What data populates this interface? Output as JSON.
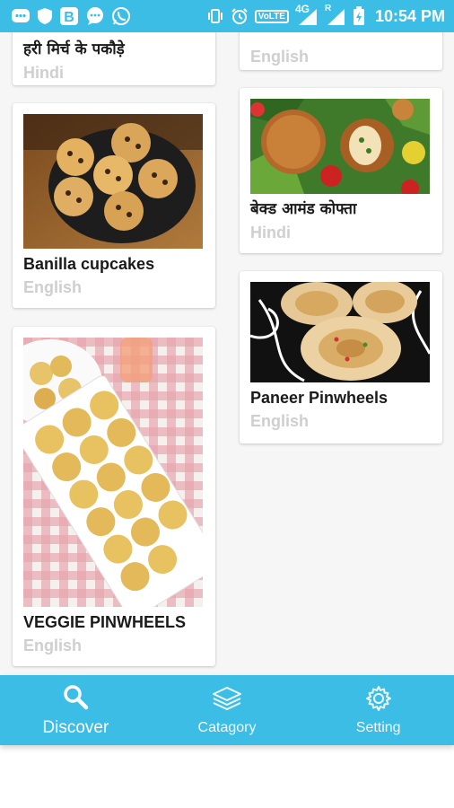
{
  "status_bar": {
    "time": "10:54 PM",
    "network_type": "4G",
    "volte": "VoLTE",
    "roaming": "R"
  },
  "recipes_left": [
    {
      "title": "हरी मिर्च के पकौड़े",
      "language": "Hindi",
      "image": "pakoda-photo"
    },
    {
      "title": "Banilla cupcakes",
      "language": "English",
      "image": "cupcakes-photo"
    },
    {
      "title": "VEGGIE PINWHEELS",
      "language": "English",
      "image": "veggie-pinwheels-photo"
    }
  ],
  "recipes_right": [
    {
      "title": "",
      "language": "English",
      "image": ""
    },
    {
      "title": "बेक्ड आमंड कोफ्ता",
      "language": "Hindi",
      "image": "kofta-photo"
    },
    {
      "title": "Paneer Pinwheels",
      "language": "English",
      "image": "paneer-pinwheels-photo"
    }
  ],
  "bottom_nav": {
    "items": [
      {
        "label": "Discover",
        "icon": "search-icon",
        "active": true
      },
      {
        "label": "Catagory",
        "icon": "layers-icon",
        "active": false
      },
      {
        "label": "Setting",
        "icon": "gear-icon",
        "active": false
      }
    ]
  },
  "colors": {
    "primary": "#3bbde6",
    "language_text": "#cfcfcf",
    "background": "#f6f6f6"
  }
}
